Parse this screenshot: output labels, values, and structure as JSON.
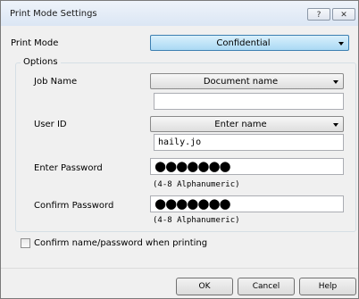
{
  "window": {
    "title": "Print Mode Settings",
    "help_glyph": "?",
    "close_glyph": "✕"
  },
  "print_mode": {
    "label": "Print Mode",
    "value": "Confidential"
  },
  "options": {
    "group_title": "Options",
    "job_name": {
      "label": "Job Name",
      "select_value": "Document name",
      "input_value": ""
    },
    "user_id": {
      "label": "User ID",
      "select_value": "Enter name",
      "input_value": "haily.jo"
    },
    "enter_password": {
      "label": "Enter Password",
      "masked_value": "●●●●●●●",
      "hint": "(4-8 Alphanumeric)"
    },
    "confirm_password": {
      "label": "Confirm Password",
      "masked_value": "●●●●●●●",
      "hint": "(4-8 Alphanumeric)"
    }
  },
  "confirm_checkbox": {
    "label": "Confirm name/password when printing",
    "checked": false
  },
  "buttons": {
    "ok": "OK",
    "cancel": "Cancel",
    "help": "Help"
  },
  "colors": {
    "active_combo": "#aad9f4",
    "dialog_bg": "#f0f0f0"
  }
}
